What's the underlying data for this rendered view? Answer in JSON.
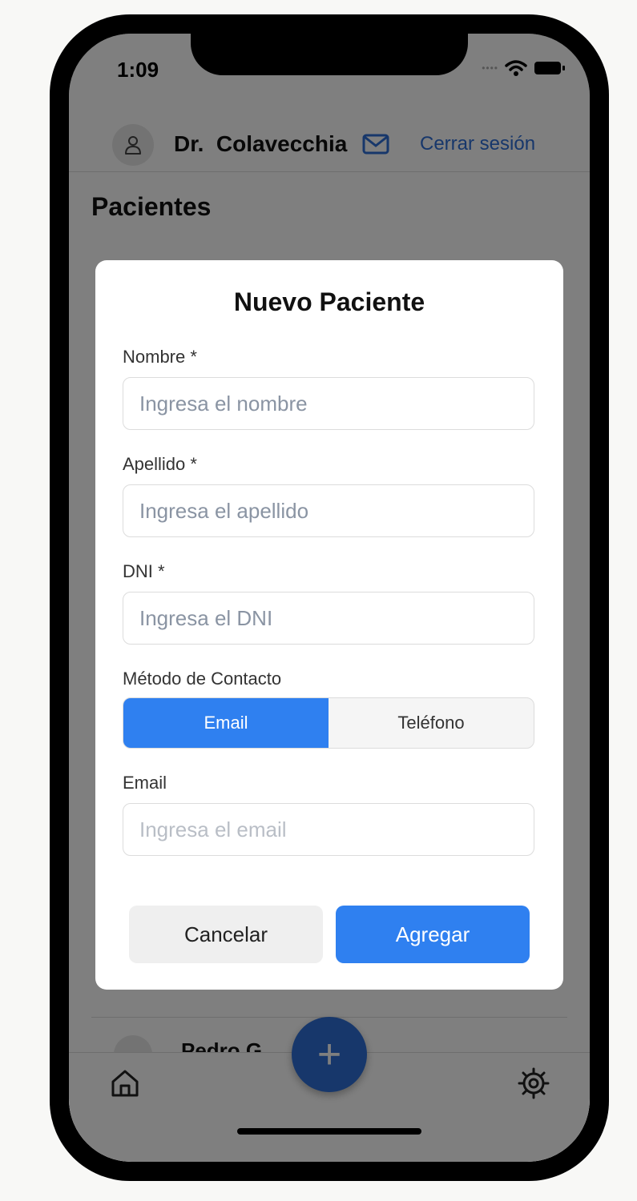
{
  "status_bar": {
    "time": "1:09"
  },
  "header": {
    "doctor_name": "Dr.  Colavecchia",
    "logout_label": "Cerrar sesión"
  },
  "page": {
    "title": "Pacientes"
  },
  "background_list": [
    {
      "name": "Pedro G..."
    }
  ],
  "modal": {
    "title": "Nuevo Paciente",
    "fields": [
      {
        "label": "Nombre *",
        "placeholder": "Ingresa el nombre"
      },
      {
        "label": "Apellido *",
        "placeholder": "Ingresa el apellido"
      },
      {
        "label": "DNI *",
        "placeholder": "Ingresa el DNI"
      }
    ],
    "contact_method": {
      "label": "Método de Contacto",
      "options": [
        "Email",
        "Teléfono"
      ],
      "selected": "Email"
    },
    "email": {
      "label": "Email",
      "placeholder": "Ingresa el email"
    },
    "buttons": {
      "cancel": "Cancelar",
      "add": "Agregar"
    }
  },
  "fab": {
    "label": "+"
  },
  "colors": {
    "accent": "#2f80f0",
    "link": "#2f6fd6",
    "overlay": "rgba(0,0,0,0.5)"
  },
  "icons": [
    "user-icon",
    "mail-icon",
    "home-icon",
    "gear-icon",
    "plus-icon",
    "wifi-icon",
    "battery-icon"
  ]
}
